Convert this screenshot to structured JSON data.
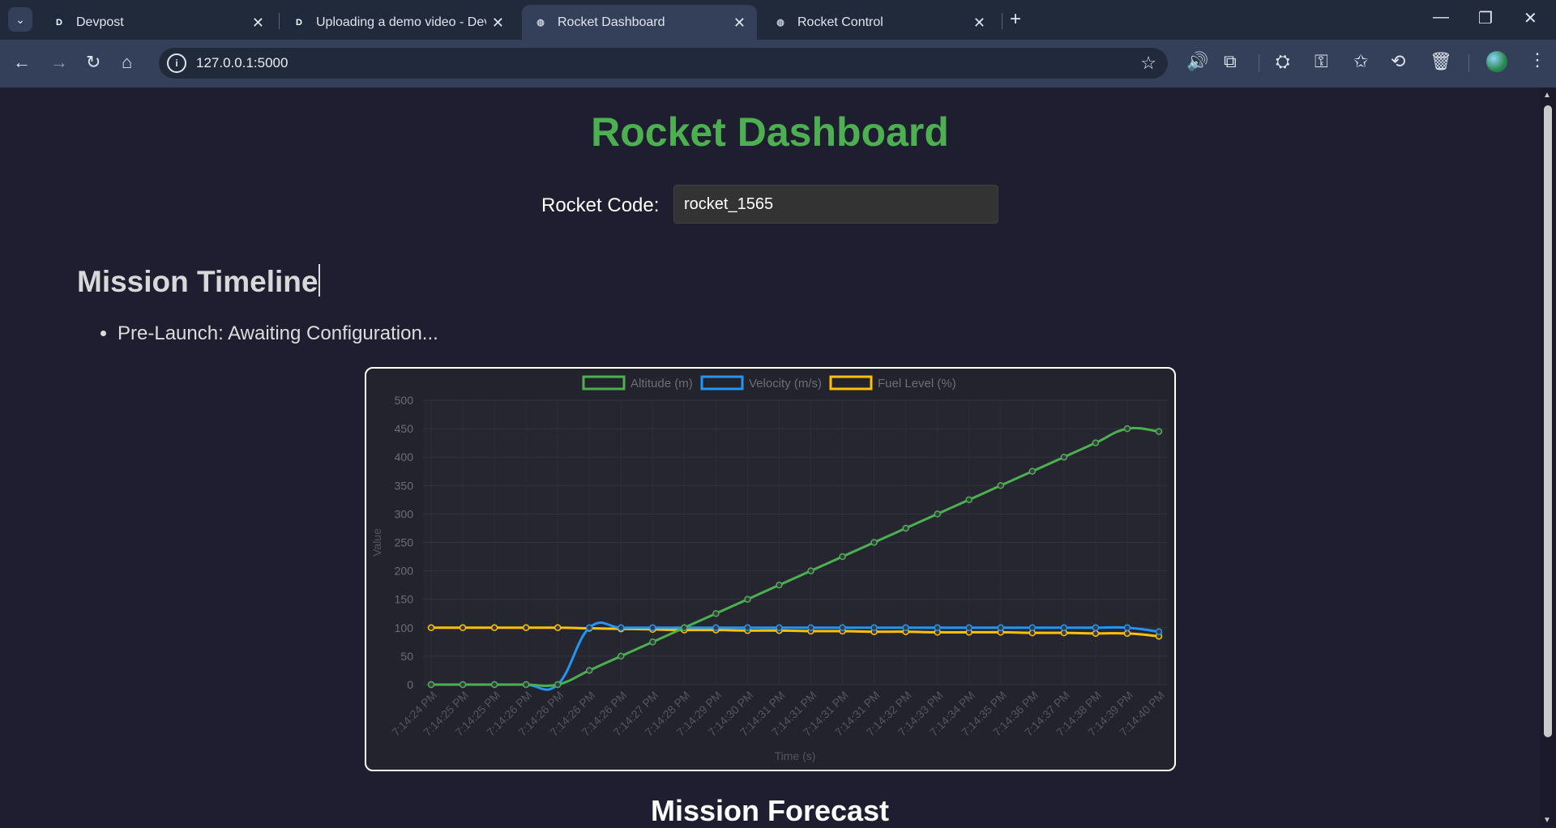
{
  "browser": {
    "tabs": [
      {
        "title": "Devpost",
        "favicon": "D",
        "active": false
      },
      {
        "title": "Uploading a demo video - Devpost",
        "favicon": "D",
        "active": false
      },
      {
        "title": "Rocket Dashboard",
        "favicon": "globe-icon",
        "active": true
      },
      {
        "title": "Rocket Control",
        "favicon": "globe-icon",
        "active": false
      }
    ],
    "url": "127.0.0.1:5000"
  },
  "page": {
    "title": "Rocket Dashboard",
    "rocket_code_label": "Rocket Code:",
    "rocket_code_value": "rocket_1565",
    "timeline_heading": "Mission Timeline",
    "timeline_items": [
      "Pre-Launch: Awaiting Configuration..."
    ],
    "forecast_heading": "Mission Forecast"
  },
  "chart_data": {
    "type": "line",
    "xlabel": "Time (s)",
    "ylabel": "Value",
    "ylim": [
      0,
      500
    ],
    "yticks": [
      0,
      50,
      100,
      150,
      200,
      250,
      300,
      350,
      400,
      450,
      500
    ],
    "grid": true,
    "legend": "top",
    "categories": [
      "7:14:24 PM",
      "7:14:25 PM",
      "7:14:25 PM",
      "7:14:26 PM",
      "7:14:26 PM",
      "7:14:26 PM",
      "7:14:26 PM",
      "7:14:27 PM",
      "7:14:28 PM",
      "7:14:29 PM",
      "7:14:30 PM",
      "7:14:31 PM",
      "7:14:31 PM",
      "7:14:31 PM",
      "7:14:31 PM",
      "7:14:32 PM",
      "7:14:33 PM",
      "7:14:34 PM",
      "7:14:35 PM",
      "7:14:36 PM",
      "7:14:37 PM",
      "7:14:38 PM",
      "7:14:39 PM",
      "7:14:40 PM"
    ],
    "series": [
      {
        "name": "Altitude (m)",
        "color": "#4caf50",
        "values": [
          0,
          0,
          0,
          0,
          0,
          25,
          50,
          75,
          100,
          125,
          150,
          175,
          200,
          225,
          250,
          275,
          300,
          325,
          350,
          375,
          400,
          425,
          450,
          445
        ]
      },
      {
        "name": "Velocity (m/s)",
        "color": "#2196f3",
        "values": [
          0,
          0,
          0,
          0,
          0,
          100,
          100,
          100,
          100,
          100,
          100,
          100,
          100,
          100,
          100,
          100,
          100,
          100,
          100,
          100,
          100,
          100,
          100,
          93
        ]
      },
      {
        "name": "Fuel Level (%)",
        "color": "#ffc107",
        "values": [
          100,
          100,
          100,
          100,
          100,
          99,
          98,
          97,
          96,
          96,
          95,
          95,
          94,
          94,
          93,
          93,
          92,
          92,
          92,
          91,
          91,
          90,
          90,
          85
        ]
      }
    ]
  }
}
